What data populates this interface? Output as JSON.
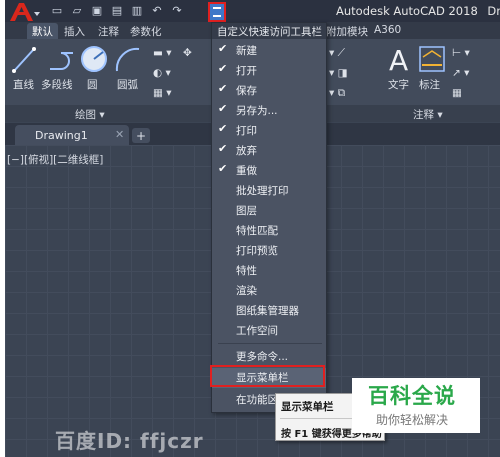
{
  "window": {
    "title": "Autodesk AutoCAD 2018",
    "title_tail": "Drawi"
  },
  "quick_access": {
    "icons": [
      "new-file-icon",
      "open-folder-icon",
      "save-icon",
      "save-as-icon",
      "print-icon",
      "undo-icon",
      "redo-icon"
    ],
    "dropdown_icon": "customize-qat-dropdown-icon"
  },
  "ribbon_tabs": [
    "默认",
    "插入",
    "注释",
    "参数化",
    "附加模块",
    "A360"
  ],
  "ribbon": {
    "tools": [
      "直线",
      "多段线",
      "圆",
      "圆弧",
      "文字",
      "标注"
    ],
    "panels": [
      "绘图 ▾",
      "注释 ▾"
    ]
  },
  "doc_tabs": {
    "active": "Drawing1",
    "close": "✕",
    "new_tab": "+"
  },
  "viewport_label": "[−][俯视][二维线框]",
  "menu": {
    "title": "自定义快速访问工具栏",
    "items": [
      {
        "label": "新建",
        "checked": "✔"
      },
      {
        "label": "打开",
        "checked": "✔"
      },
      {
        "label": "保存",
        "checked": "✔"
      },
      {
        "label": "另存为...",
        "checked": "✔"
      },
      {
        "label": "打印",
        "checked": "✔"
      },
      {
        "label": "放弃",
        "checked": "✔"
      },
      {
        "label": "重做",
        "checked": "✔"
      },
      {
        "label": "批处理打印",
        "checked": ""
      },
      {
        "label": "图层",
        "checked": ""
      },
      {
        "label": "特性匹配",
        "checked": ""
      },
      {
        "label": "打印预览",
        "checked": ""
      },
      {
        "label": "特性",
        "checked": ""
      },
      {
        "label": "渲染",
        "checked": ""
      },
      {
        "label": "图纸集管理器",
        "checked": ""
      },
      {
        "label": "工作空间",
        "checked": ""
      },
      {
        "label": "更多命令...",
        "checked": ""
      },
      {
        "label": "显示菜单栏",
        "checked": ""
      },
      {
        "label": "在功能区",
        "checked": ""
      }
    ]
  },
  "tooltip": {
    "title": "显示菜单栏",
    "hint": "按 F1 键获得更多帮助"
  },
  "watermark": {
    "baike_title": "百科全说",
    "baike_sub": "助你轻松解决",
    "baidu": "百度ID: ffjczr"
  },
  "colors": {
    "highlight_border": "#e02020",
    "menu_bg": "#4b5363",
    "canvas_bg": "#3b4453",
    "baike_green": "#2aa84a"
  }
}
